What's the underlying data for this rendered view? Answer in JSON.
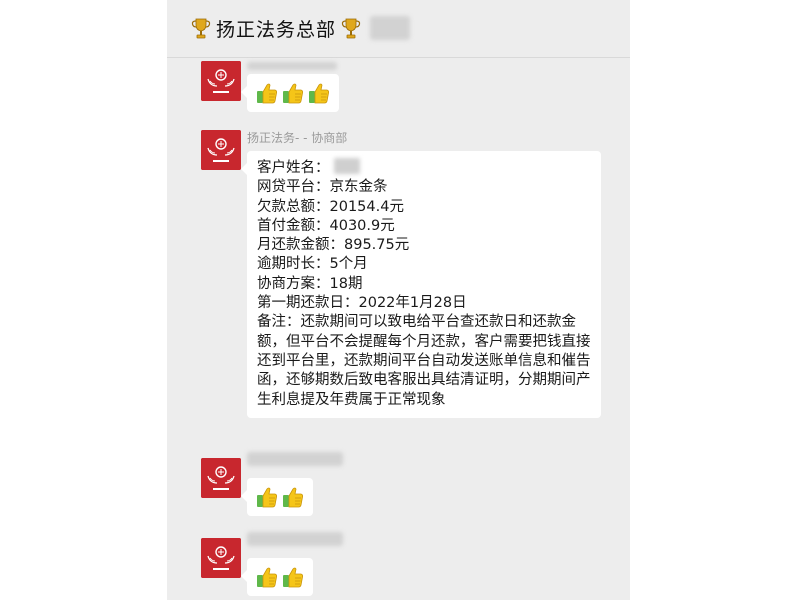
{
  "window": {
    "title": "扬正法务总部"
  },
  "messages": [
    {
      "sender": "",
      "emoji": [
        "thumbs-up",
        "thumbs-up",
        "thumbs-up"
      ]
    },
    {
      "sender": "扬正法务- - 协商部",
      "lines": [
        "客户姓名：",
        "网贷平台：京东金条",
        "欠款总额：20154.4元",
        "首付金额：4030.9元",
        "月还款金额：895.75元",
        "逾期时长：5个月",
        "协商方案：18期",
        "第一期还款日：2022年1月28日",
        "备注：还款期间可以致电给平台查还款日和还款金额，但平台不会提醒每个月还款，客户需要把钱直接还到平台里，还款期间平台自动发送账单信息和催告函，还够期数后致电客服出具结清证明，分期期间产生利息提及年费属于正常现象"
      ]
    },
    {
      "sender": "",
      "emoji": [
        "thumbs-up",
        "thumbs-up"
      ]
    },
    {
      "sender": "",
      "emoji": [
        "thumbs-up",
        "thumbs-up"
      ]
    }
  ],
  "colors": {
    "chat_bg": "#ededed",
    "bubble": "#ffffff",
    "avatar": "#c8272e",
    "trophy": "#e0a81c",
    "thumb": "#f5c518",
    "cuff": "#5fb84a"
  }
}
